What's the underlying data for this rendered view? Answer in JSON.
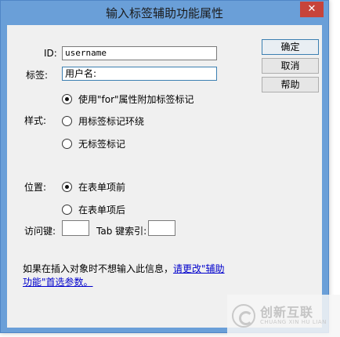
{
  "window": {
    "title": "输入标签辅助功能属性",
    "close_glyph": "✕"
  },
  "form": {
    "id_label": "ID:",
    "id_value": "username",
    "label_label": "标签:",
    "label_value": "用户名:",
    "style_label": "样式:",
    "style_options": [
      {
        "label": "使用\"for\"属性附加标签标记",
        "checked": true
      },
      {
        "label": "用标签标记环绕",
        "checked": false
      },
      {
        "label": "无标签标记",
        "checked": false
      }
    ],
    "position_label": "位置:",
    "position_options": [
      {
        "label": "在表单项前",
        "checked": true
      },
      {
        "label": "在表单项后",
        "checked": false
      }
    ],
    "access_key_label": "访问键:",
    "access_key_value": "",
    "tab_index_label": "Tab 键索引:",
    "tab_index_value": ""
  },
  "buttons": {
    "ok": "确定",
    "cancel": "取消",
    "help": "帮助"
  },
  "note": {
    "text": "如果在插入对象时不想输入此信息，",
    "link": "请更改\"辅助功能\"首选参数。"
  },
  "watermark": {
    "name": "创新互联",
    "subtitle": "CHUANG XIN HU LIAN"
  }
}
